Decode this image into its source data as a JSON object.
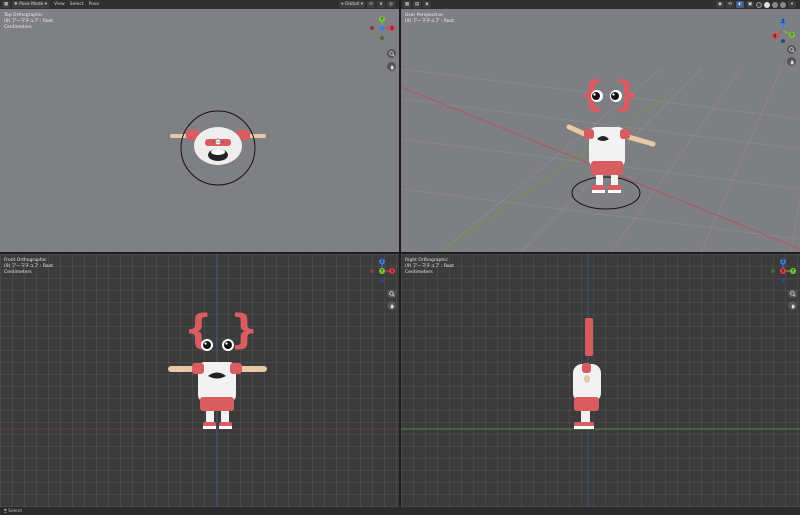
{
  "header_left": {
    "mode": "Pose Mode",
    "menus": [
      "View",
      "Select",
      "Pose"
    ],
    "orientation": "Global"
  },
  "viewports": {
    "top_left": {
      "lines": [
        "Top Orthographic",
        "(9) アーマチュア : Root",
        "Centimeters"
      ]
    },
    "top_right": {
      "lines": [
        "User Perspective",
        "(9) アーマチュア : Root"
      ]
    },
    "bottom_left": {
      "lines": [
        "Front Orthographic",
        "(9) アーマチュア : Root",
        "Centimeters"
      ]
    },
    "bottom_right": {
      "lines": [
        "Right Orthographic",
        "(9) アーマチュア : Root",
        "Centimeters"
      ]
    }
  },
  "gizmo_axes": {
    "x": "X",
    "y": "Y",
    "z": "Z"
  },
  "colors": {
    "axis_x": "#e63b4e",
    "axis_y": "#7fc33a",
    "axis_z": "#3d7de0",
    "character_red": "#d95c60",
    "character_white": "#f2f2f2",
    "skin": "#e8c9a6"
  },
  "icons": [
    "editor-type-icon",
    "mode-icon",
    "orientation-icon",
    "zoom-icon",
    "hand-icon",
    "shading-icon",
    "overlay-icon",
    "gizmo-icon"
  ],
  "status": {
    "text": "Select"
  }
}
